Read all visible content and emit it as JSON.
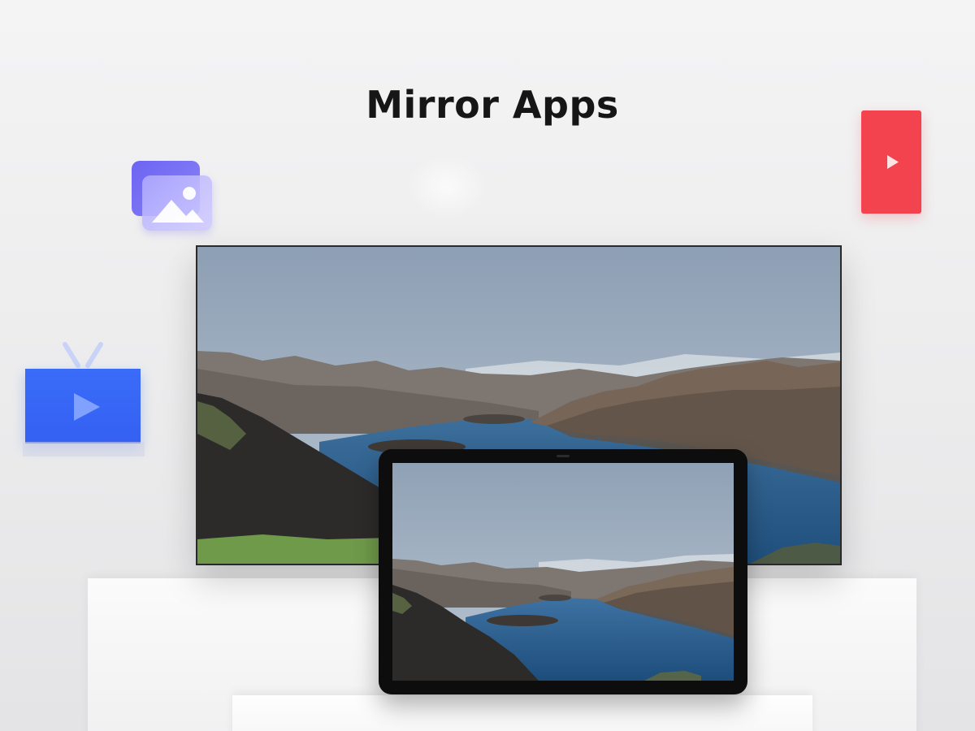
{
  "title": "Mirror Apps",
  "icons": {
    "gallery": "image-gallery-icon",
    "video": "red-play-icon",
    "tv": "tv-play-icon"
  },
  "colors": {
    "background": "#efeff0",
    "title": "#161616",
    "gallery_back": "#6c64f2",
    "gallery_front": "#c4bfff",
    "red_play": "#f2434e",
    "tv_blue": "#3a6cf8",
    "monitor_bezel": "#2a2a2a",
    "tablet_bezel": "#0d0d0d",
    "sky": "#a6b6c6",
    "lake": "#2c5f8e",
    "mountain": "#6b5d52",
    "grass": "#6f9a4a"
  },
  "devices": {
    "monitor": "monitor-landscape-screen",
    "tablet": "tablet-landscape-screen"
  }
}
